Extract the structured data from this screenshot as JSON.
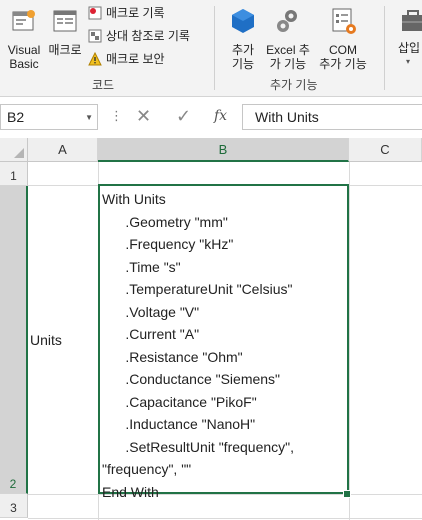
{
  "ribbon": {
    "visual_basic": [
      "Visual",
      "Basic"
    ],
    "macros": "매크로",
    "record_macro": "매크로 기록",
    "relative_refs": "상대 참조로 기록",
    "macro_security": "매크로 보안",
    "group_code": "코드",
    "addins": [
      "추가",
      "기능"
    ],
    "excel_addins": [
      "Excel 추",
      "가 기능"
    ],
    "com_addins": [
      "COM",
      "추가 기능"
    ],
    "group_addins": "추가 기능",
    "insert": "삽입"
  },
  "formula_bar": {
    "name_box": "B2",
    "fx_label": "fx",
    "formula": "With Units"
  },
  "sheet": {
    "columns": [
      "A",
      "B",
      "C"
    ],
    "rows": [
      "1",
      "2",
      "3"
    ],
    "cell_a2": "Units",
    "cell_b2_lines": [
      "With Units",
      "      .Geometry \"mm\"",
      "      .Frequency \"kHz\"",
      "      .Time \"s\"",
      "      .TemperatureUnit \"Celsius\"",
      "      .Voltage \"V\"",
      "      .Current \"A\"",
      "      .Resistance \"Ohm\"",
      "      .Conductance \"Siemens\"",
      "      .Capacitance \"PikoF\"",
      "      .Inductance \"NanoH\"",
      "      .SetResultUnit \"frequency\",",
      "\"frequency\", \"\"",
      "End With"
    ]
  },
  "colors": {
    "accent": "#217346"
  }
}
